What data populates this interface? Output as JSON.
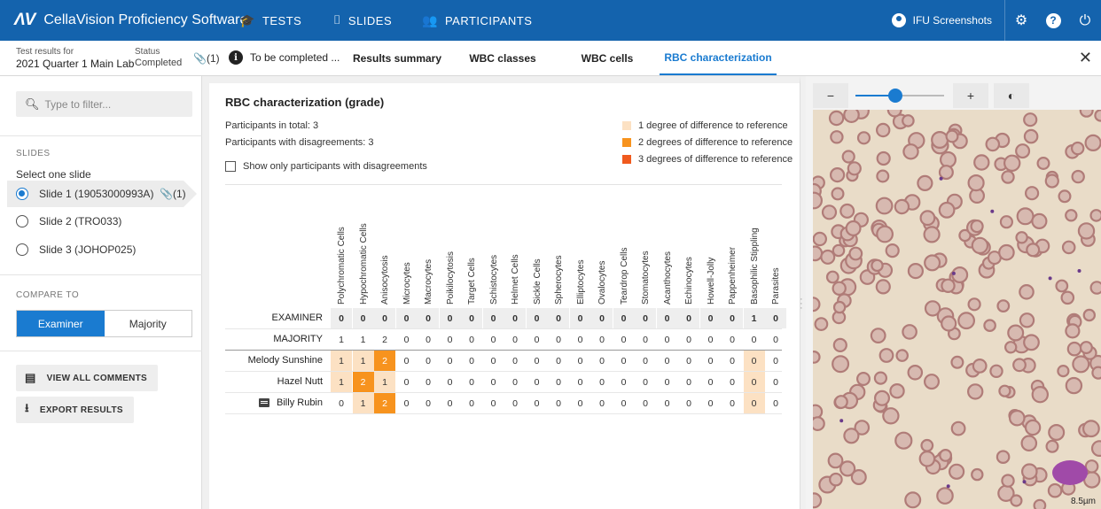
{
  "topbar": {
    "logo": "ΛV",
    "app_title": "CellaVision Proficiency Software",
    "nav": [
      {
        "label": "TESTS",
        "icon": "graduation-cap-icon"
      },
      {
        "label": "SLIDES",
        "icon": "slide-icon"
      },
      {
        "label": "PARTICIPANTS",
        "icon": "people-icon"
      }
    ],
    "user": "IFU Screenshots"
  },
  "subheader": {
    "test_results_label": "Test results for",
    "test_results_value": "2021 Quarter 1 Main Lab",
    "status_label": "Status",
    "status_value": "Completed",
    "attachments": "(1)",
    "to_be_completed": "To be completed ...",
    "tabs": [
      "Results summary",
      "WBC classes",
      "WBC cells",
      "RBC characterization"
    ],
    "active_tab": "RBC characterization"
  },
  "sidebar": {
    "filter_placeholder": "Type to filter...",
    "slides_heading": "SLIDES",
    "select_prompt": "Select one slide",
    "slides": [
      {
        "label": "Slide 1 (19053000993A)",
        "selected": true,
        "attachments": "(1)"
      },
      {
        "label": "Slide 2 (TRO033)",
        "selected": false
      },
      {
        "label": "Slide 3 (JOHOP025)",
        "selected": false
      }
    ],
    "compare_heading": "COMPARE TO",
    "compare_options": [
      "Examiner",
      "Majority"
    ],
    "compare_selected": "Examiner",
    "view_comments": "VIEW ALL COMMENTS",
    "export_results": "EXPORT RESULTS"
  },
  "main": {
    "title": "RBC characterization (grade)",
    "participants_total": "Participants in total: 3",
    "participants_disagree": "Participants with disagreements: 3",
    "show_only_label": "Show only participants with disagreements",
    "legend": [
      {
        "label": "1 degree of difference to reference",
        "color": "#fce1c3"
      },
      {
        "label": "2 degrees of difference to reference",
        "color": "#f7931e"
      },
      {
        "label": "3 degrees of difference to reference",
        "color": "#f05a1e"
      }
    ],
    "columns": [
      "Polychromatic Cells",
      "Hypochromatic Cells",
      "Anisocytosis",
      "Microcytes",
      "Macrocytes",
      "Poikilocytosis",
      "Target Cells",
      "Schistocytes",
      "Helmet Cells",
      "Sickle Cells",
      "Spherocytes",
      "Elliptocytes",
      "Ovalocytes",
      "Teardrop Cells",
      "Stomatocytes",
      "Acanthocytes",
      "Echinocytes",
      "Howell-Jolly",
      "Pappenheimer",
      "Basophilic Stippling",
      "Parasites"
    ],
    "reference_rows": [
      {
        "label": "EXAMINER",
        "values": [
          "0",
          "0",
          "0",
          "0",
          "0",
          "0",
          "0",
          "0",
          "0",
          "0",
          "0",
          "0",
          "0",
          "0",
          "0",
          "0",
          "0",
          "0",
          "0",
          "1",
          "0"
        ]
      },
      {
        "label": "MAJORITY",
        "values": [
          "1",
          "1",
          "2",
          "0",
          "0",
          "0",
          "0",
          "0",
          "0",
          "0",
          "0",
          "0",
          "0",
          "0",
          "0",
          "0",
          "0",
          "0",
          "0",
          "0",
          "0"
        ]
      }
    ],
    "participant_rows": [
      {
        "label": "Melody Sunshine",
        "comment": false,
        "values": [
          "1",
          "1",
          "2",
          "0",
          "0",
          "0",
          "0",
          "0",
          "0",
          "0",
          "0",
          "0",
          "0",
          "0",
          "0",
          "0",
          "0",
          "0",
          "0",
          "0",
          "0"
        ],
        "diff": [
          1,
          1,
          2,
          0,
          0,
          0,
          0,
          0,
          0,
          0,
          0,
          0,
          0,
          0,
          0,
          0,
          0,
          0,
          0,
          1,
          0
        ]
      },
      {
        "label": "Hazel Nutt",
        "comment": false,
        "values": [
          "1",
          "2",
          "1",
          "0",
          "0",
          "0",
          "0",
          "0",
          "0",
          "0",
          "0",
          "0",
          "0",
          "0",
          "0",
          "0",
          "0",
          "0",
          "0",
          "0",
          "0"
        ],
        "diff": [
          1,
          2,
          1,
          0,
          0,
          0,
          0,
          0,
          0,
          0,
          0,
          0,
          0,
          0,
          0,
          0,
          0,
          0,
          0,
          1,
          0
        ]
      },
      {
        "label": "Billy Rubin",
        "comment": true,
        "values": [
          "0",
          "1",
          "2",
          "0",
          "0",
          "0",
          "0",
          "0",
          "0",
          "0",
          "0",
          "0",
          "0",
          "0",
          "0",
          "0",
          "0",
          "0",
          "0",
          "0",
          "0"
        ],
        "diff": [
          0,
          1,
          2,
          0,
          0,
          0,
          0,
          0,
          0,
          0,
          0,
          0,
          0,
          0,
          0,
          0,
          0,
          0,
          0,
          1,
          0
        ]
      }
    ]
  },
  "viewer": {
    "zoom_level": 0.45,
    "scale_label": "8.5µm"
  }
}
